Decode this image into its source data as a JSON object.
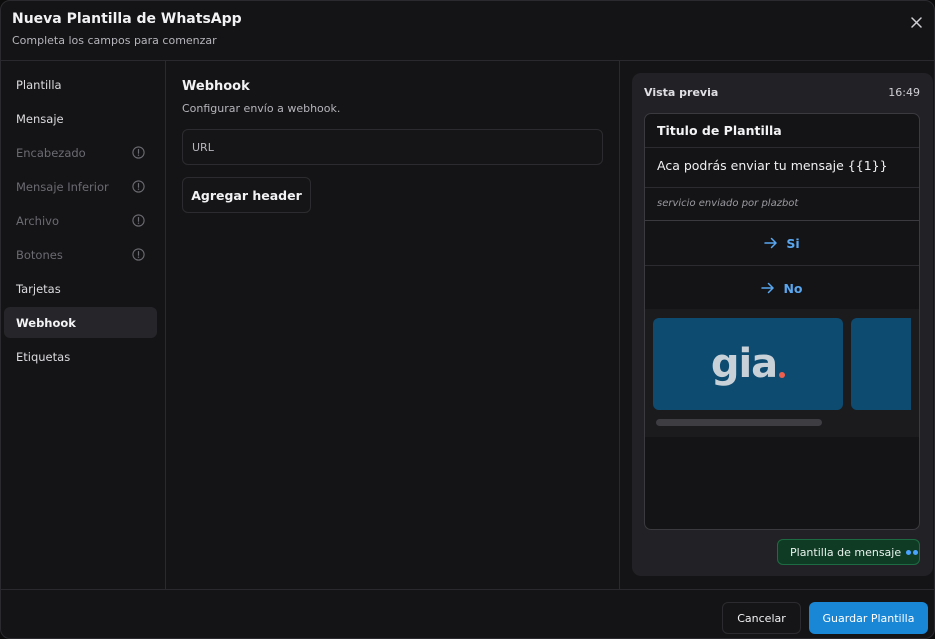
{
  "header": {
    "title": "Nueva Plantilla de WhatsApp",
    "subtitle": "Completa los campos para comenzar",
    "close_icon": "close-icon"
  },
  "sidebar": {
    "items": [
      {
        "label": "Plantilla",
        "state": "enabled"
      },
      {
        "label": "Mensaje",
        "state": "enabled"
      },
      {
        "label": "Encabezado",
        "state": "disabled",
        "icon": "info-icon"
      },
      {
        "label": "Mensaje Inferior",
        "state": "disabled",
        "icon": "info-icon"
      },
      {
        "label": "Archivo",
        "state": "disabled",
        "icon": "info-icon"
      },
      {
        "label": "Botones",
        "state": "disabled",
        "icon": "info-icon"
      },
      {
        "label": "Tarjetas",
        "state": "enabled"
      },
      {
        "label": "Webhook",
        "state": "active"
      },
      {
        "label": "Etiquetas",
        "state": "enabled"
      }
    ]
  },
  "main": {
    "section_title": "Webhook",
    "section_desc": "Configurar envío a webhook.",
    "url_placeholder": "URL",
    "url_value": "",
    "add_header_label": "Agregar header"
  },
  "preview": {
    "label": "Vista previa",
    "time": "16:49",
    "card": {
      "title": "Titulo de Plantilla",
      "body": "Aca podrás enviar tu mensaje {{1}}",
      "footer": "servicio enviado por plazbot",
      "buttons": [
        {
          "label": "Si",
          "icon": "arrow-right-icon"
        },
        {
          "label": "No",
          "icon": "arrow-right-icon"
        }
      ],
      "carousel_logo": "gia"
    },
    "badge_label": "Plantilla de mensaje"
  },
  "footer": {
    "cancel_label": "Cancelar",
    "save_label": "Guardar Plantilla"
  },
  "colors": {
    "accent": "#1a86d6",
    "link": "#5aa7f0",
    "badge_bg": "#0f3b25",
    "card_image_bg": "#0d4b70",
    "logo_dot": "#ef5f4e"
  }
}
